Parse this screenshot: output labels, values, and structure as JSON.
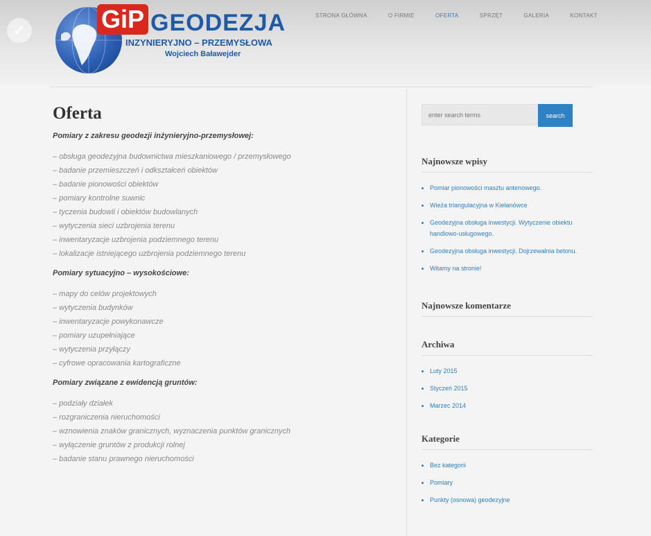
{
  "header": {
    "logo_badge": "GiP",
    "brand_name": "GEODEZJA",
    "brand_subtitle": "INZYNIERYJNO – PRZEMYSŁOWA",
    "brand_owner": "Wojciech Baławejder",
    "check_icon": "✓"
  },
  "nav": [
    "STRONA GŁÓWNA",
    "O FIRMIE",
    "OFERTA",
    "SPRZĘT",
    "GALERIA",
    "KONTAKT"
  ],
  "main": {
    "title": "Oferta",
    "sections": [
      {
        "title": "Pomiary z zakresu geodezji inżynieryjno-przemysłowej:",
        "items": [
          "– obsługa geodezyjna budownictwa mieszkaniowego / przemysłowego",
          "– badanie przemieszczeń i odkształceń obiektów",
          "– badanie pionowości obiektów",
          "– pomiary kontrolne suwnic",
          "– tyczenia budowli i obiektów budowlanych",
          "– wytyczenia sieci uzbrojenia terenu",
          "– inwentaryzacje uzbrojenia podziemnego terenu",
          "– lokalizacje istniejącego uzbrojenia podziemnego terenu"
        ]
      },
      {
        "title": "Pomiary sytuacyjno – wysokościowe:",
        "items": [
          "– mapy do celów projektowych",
          "– wytyczenia budynków",
          "– inwentaryzacje powykonawcze",
          "– pomiary uzupełniające",
          "– wytyczenia przyłączy",
          "– cyfrowe opracowania kartograficzne"
        ]
      },
      {
        "title": "Pomiary związane z ewidencją gruntów:",
        "items": [
          "– podziały działek",
          "– rozgraniczenia nieruchomości",
          "– wznowienia znaków granicznych, wyznaczenia punktów granicznych",
          "– wyłączenie gruntów z produkcji rolnej",
          "– badanie stanu prawnego nieruchomości"
        ]
      }
    ]
  },
  "sidebar": {
    "search": {
      "placeholder": "enter search terms",
      "button": "search"
    },
    "widgets": [
      {
        "title": "Najnowsze wpisy",
        "items": [
          "Pomiar pionowości masztu antenowego.",
          "Wieża triangulacyjna w Kielanówce",
          "Geodezyjna obsługa inwestycji. Wytyczenie obiektu handlowo-usługowego.",
          "Geodezyjna obsługa inwestycji. Dojrzewalnia betonu.",
          "Witamy na stronie!"
        ]
      },
      {
        "title": "Najnowsze komentarze",
        "items": []
      },
      {
        "title": "Archiwa",
        "items": [
          "Luty 2015",
          "Styczeń 2015",
          "Marzec 2014"
        ]
      },
      {
        "title": "Kategorie",
        "items": [
          "Bez kategorii",
          "Pomiary",
          "Punkty (osnowa) geodezyjne"
        ]
      }
    ]
  }
}
